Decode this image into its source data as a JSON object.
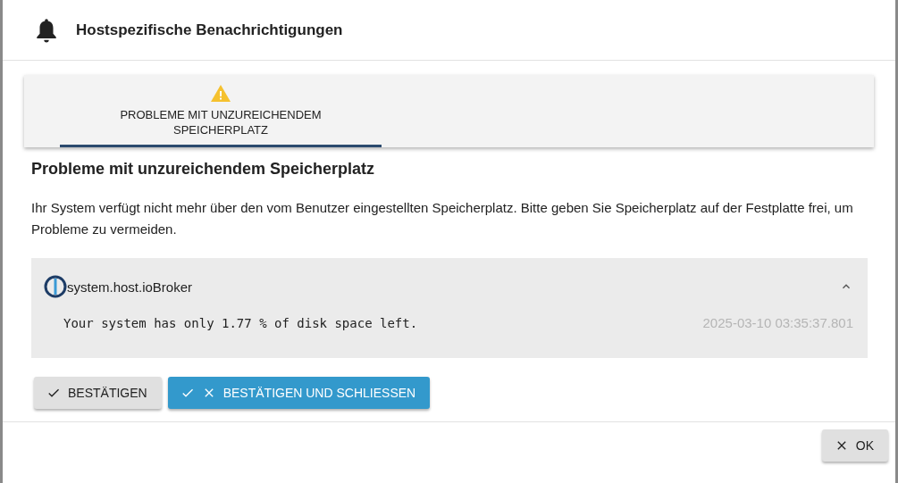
{
  "window": {
    "title": "Hostspezifische Benachrichtigungen"
  },
  "tabs": [
    {
      "label": "PROBLEME MIT UNZUREICHENDEM SPEICHERPLATZ",
      "selected": true
    }
  ],
  "section": {
    "heading": "Probleme mit unzureichendem Speicherplatz",
    "description": "Ihr System verfügt nicht mehr über den vom Benutzer eingestellten Speicherplatz. Bitte geben Sie Speicherplatz auf der Festplatte frei, um Probleme zu vermeiden."
  },
  "notifications": [
    {
      "host": "system.host.ioBroker",
      "expanded": true,
      "message": "Your system has only 1.77 % of disk space left.",
      "timestamp": "2025-03-10 03:35:37.801"
    }
  ],
  "actions": [
    {
      "kind": "confirm",
      "label": "BESTÄTIGEN"
    },
    {
      "kind": "confirm-close",
      "label": "BESTÄTIGEN UND SCHLIESSEN"
    }
  ],
  "footer": {
    "buttons": [
      {
        "kind": "close",
        "label": "OK"
      }
    ]
  }
}
